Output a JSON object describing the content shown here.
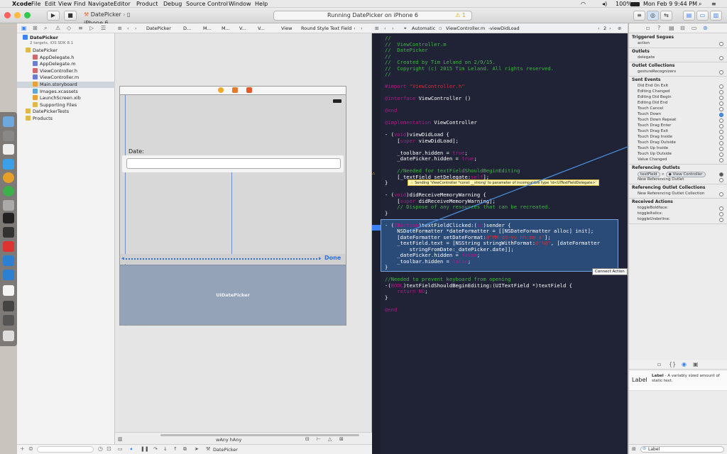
{
  "menubar": {
    "app": "Xcode",
    "items": [
      "File",
      "Edit",
      "View",
      "Find",
      "Navigate",
      "Editor",
      "Product",
      "Debug",
      "Source Control",
      "Window",
      "Help"
    ],
    "battery": "100%",
    "clock": "Mon Feb 9  9:44 PM"
  },
  "toolbar": {
    "scheme": "DatePicker",
    "device": "iPhone 6",
    "status": "Running DatePicker on iPhone 6",
    "warning_count": "1"
  },
  "navigator": {
    "project": "DatePicker",
    "project_sub": "2 targets, iOS SDK 8.1",
    "items": [
      {
        "label": "DatePicker",
        "level": 1,
        "kind": "folder"
      },
      {
        "label": "AppDelegate.h",
        "level": 2,
        "kind": "h"
      },
      {
        "label": "AppDelegate.m",
        "level": 2,
        "kind": "m"
      },
      {
        "label": "ViewController.h",
        "level": 2,
        "kind": "h"
      },
      {
        "label": "ViewController.m",
        "level": 2,
        "kind": "m"
      },
      {
        "label": "Main.storyboard",
        "level": 2,
        "kind": "sb",
        "selected": true
      },
      {
        "label": "Images.xcassets",
        "level": 2,
        "kind": "asset"
      },
      {
        "label": "LaunchScreen.xib",
        "level": 2,
        "kind": "xib"
      },
      {
        "label": "Supporting Files",
        "level": 2,
        "kind": "folder"
      },
      {
        "label": "DatePickerTests",
        "level": 1,
        "kind": "folder"
      },
      {
        "label": "Products",
        "level": 1,
        "kind": "folder"
      }
    ]
  },
  "canvas": {
    "breadcrumbs": [
      "DatePicker",
      "D...",
      "M...",
      "M...",
      "V...",
      "V...",
      "View",
      "Round Style Text Field"
    ],
    "date_label": "Date:",
    "done_label": "Done",
    "picker_label": "UIDatePicker",
    "size_class": "wAny hAny"
  },
  "editor": {
    "mode": "Automatic",
    "file": "ViewController.m",
    "symbol": "-viewDidLoad",
    "counter": "2",
    "warning_text": "Sending 'ViewController *const __strong' to parameter of incompatible type 'id<UITextFieldDelegate>'",
    "connect_tooltip": "Connect Action",
    "lines": [
      "//",
      "//  ViewController.m",
      "//  DatePicker",
      "//",
      "//  Created by Tim Leland on 2/9/15.",
      "//  Copyright (c) 2015 Tim Leland. All rights reserved.",
      "//",
      "",
      "#import \"ViewController.h\"",
      "",
      "@interface ViewController ()",
      "",
      "@end",
      "",
      "@implementation ViewController",
      "",
      "- (void)viewDidLoad {",
      "    [super viewDidLoad];",
      "",
      "    _toolbar.hidden = true;",
      "    _datePicker.hidden = true;",
      "",
      "    //Needed for textFieldShouldBeginEditing",
      "    [_textField setDelegate:self];",
      "}",
      "",
      "- (void)didReceiveMemoryWarning {",
      "    [super didReceiveMemoryWarning];",
      "    // Dispose of any resources that can be recreated.",
      "}",
      "",
      "- (IBAction)textFieldClicked:(id)sender {",
      "    NSDateFormatter *dateFormatter = [[NSDateFormatter alloc] init];",
      "    [dateFormatter setDateFormat:@\"MM-dd-yy hh:mm a\"];",
      "    _textField.text = [NSString stringWithFormat:@\"%@\", [dateFormatter",
      "        stringFromDate:_datePicker.date]];",
      "    _datePicker.hidden = false;",
      "    _toolbar.hidden = false;",
      "}",
      "",
      "//Needed to prevent keyboard from opening",
      "-(BOOL)textFieldShouldBeginEditing:(UITextField *)textField {",
      "    return NO;",
      "}",
      "",
      "@end"
    ]
  },
  "inspector": {
    "sections": [
      {
        "title": "Triggered Segues",
        "rows": [
          "action"
        ]
      },
      {
        "title": "Outlets",
        "rows": [
          "delegate"
        ]
      },
      {
        "title": "Outlet Collections",
        "rows": [
          "gestureRecognizers"
        ]
      },
      {
        "title": "Sent Events",
        "rows": [
          "Did End On Exit",
          "Editing Changed",
          "Editing Did Begin",
          "Editing Did End",
          "Touch Cancel",
          "Touch Down",
          "Touch Down Repeat",
          "Touch Drag Enter",
          "Touch Drag Exit",
          "Touch Drag Inside",
          "Touch Drag Outside",
          "Touch Up Inside",
          "Touch Up Outside",
          "Value Changed"
        ]
      },
      {
        "title": "Referencing Outlets",
        "rows": [
          "textField",
          "New Referencing Outlet"
        ]
      },
      {
        "title": "Referencing Outlet Collections",
        "rows": [
          "New Referencing Outlet Collection"
        ]
      },
      {
        "title": "Received Actions",
        "rows": [
          "toggleBoldface:",
          "toggleItalics:",
          "toggleUnderline:"
        ]
      }
    ],
    "outlet_target": "View Controller",
    "library_title": "Label",
    "library_desc_bold": "Label",
    "library_desc": " - A variably sized amount of static text.",
    "filter_text": "Label"
  },
  "bottom": {
    "filter_placeholder": "DatePicker"
  },
  "colors": {
    "editor_bg": "#1f2335",
    "comment": "#41b645",
    "keyword": "#b21889",
    "string": "#db2c38",
    "accent": "#3b82f6"
  }
}
